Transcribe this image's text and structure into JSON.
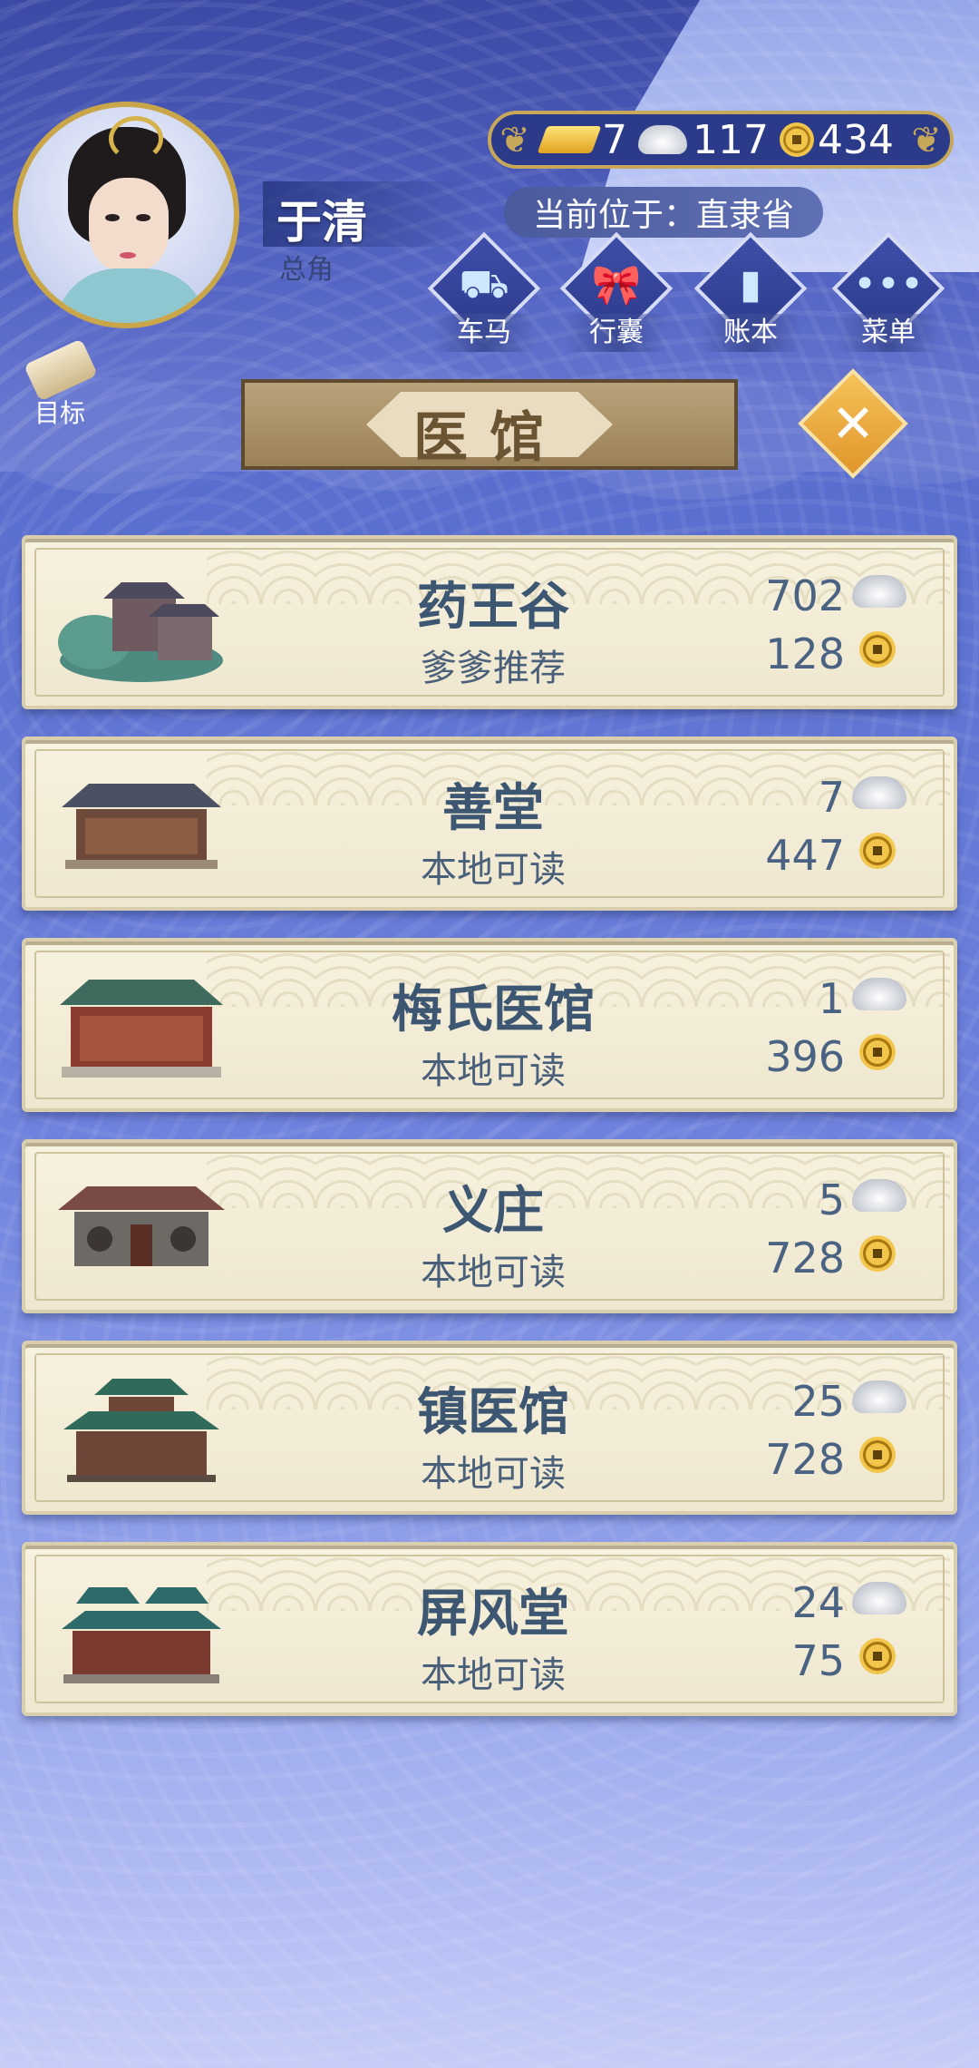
{
  "player": {
    "name": "于清",
    "role": "总角"
  },
  "currency": {
    "gold": "7",
    "silver": "117",
    "copper": "434"
  },
  "location": "当前位于：直隶省",
  "menu": [
    {
      "label": "车马",
      "icon": "carriage-icon"
    },
    {
      "label": "行囊",
      "icon": "bag-icon"
    },
    {
      "label": "账本",
      "icon": "ledger-icon"
    },
    {
      "label": "菜单",
      "icon": "menu-icon"
    }
  ],
  "goal_label": "目标",
  "title": "医馆",
  "hospitals": [
    {
      "name": "药王谷",
      "desc": "爹爹推荐",
      "silver": "702",
      "copper": "128"
    },
    {
      "name": "善堂",
      "desc": "本地可读",
      "silver": "7",
      "copper": "447"
    },
    {
      "name": "梅氏医馆",
      "desc": "本地可读",
      "silver": "1",
      "copper": "396"
    },
    {
      "name": "义庄",
      "desc": "本地可读",
      "silver": "5",
      "copper": "728"
    },
    {
      "name": "镇医馆",
      "desc": "本地可读",
      "silver": "25",
      "copper": "728"
    },
    {
      "name": "屏风堂",
      "desc": "本地可读",
      "silver": "24",
      "copper": "75"
    }
  ],
  "colors": {
    "accent_gold": "#c7a85a",
    "card_text": "#3d5773",
    "banner": "#b9a27a"
  }
}
